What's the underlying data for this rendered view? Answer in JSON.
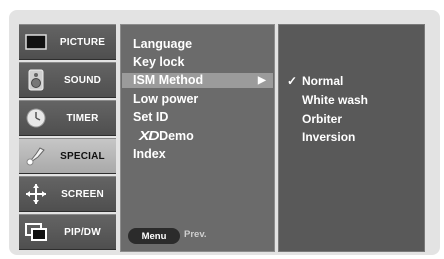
{
  "categories": [
    {
      "label": "PICTURE",
      "icon": "monitor-icon",
      "active": false
    },
    {
      "label": "SOUND",
      "icon": "speaker-icon",
      "active": false
    },
    {
      "label": "TIMER",
      "icon": "clock-icon",
      "active": false
    },
    {
      "label": "SPECIAL",
      "icon": "special-icon",
      "active": true
    },
    {
      "label": "SCREEN",
      "icon": "screen-adjust-icon",
      "active": false
    },
    {
      "label": "PIP/DW",
      "icon": "pip-icon",
      "active": false
    }
  ],
  "menu": {
    "items": [
      {
        "label": "Language"
      },
      {
        "label": "Key lock"
      },
      {
        "label": "ISM Method",
        "selected": true,
        "arrow": "▶"
      },
      {
        "label": "Low power"
      },
      {
        "label": "Set ID"
      },
      {
        "label": "Demo",
        "logo": "XD"
      },
      {
        "label": "Index"
      }
    ],
    "menu_button": "Menu",
    "prev_label": "Prev."
  },
  "submenu": {
    "check_mark": "✓",
    "items": [
      {
        "label": "Normal",
        "checked": true
      },
      {
        "label": "White wash"
      },
      {
        "label": "Orbiter"
      },
      {
        "label": "Inversion"
      }
    ]
  },
  "colors": {
    "category_bg": "#5a5a5a",
    "category_active_bg": "#b8b8b8",
    "menu_bg": "#6b6b6b",
    "menu_highlight": "#9b9b9b",
    "submenu_bg": "#595959",
    "frame_bg": "#e3e3e3"
  }
}
